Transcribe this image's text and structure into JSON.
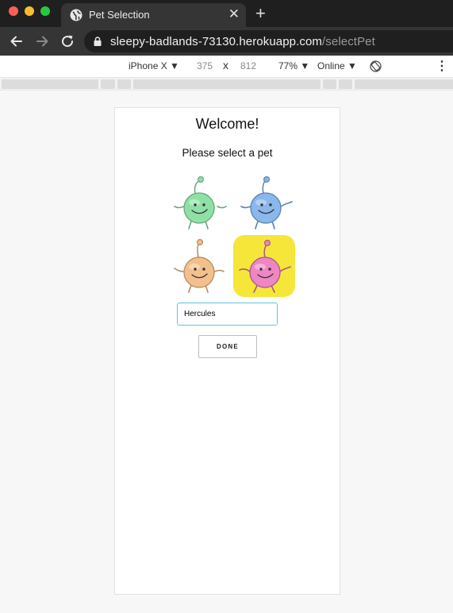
{
  "browser": {
    "tab": {
      "title": "Pet Selection",
      "close_glyph": "✕",
      "icon": "globe-icon"
    },
    "new_tab_glyph": "+",
    "address": {
      "host": "sleepy-badlands-73130.herokuapp.com",
      "path": "/selectPet",
      "icon": "lock-icon"
    },
    "nav_icons": [
      "back-arrow-icon",
      "forward-arrow-icon",
      "reload-icon"
    ]
  },
  "device_toolbar": {
    "device": "iPhone X ▼",
    "width": "375",
    "times": "x",
    "height": "812",
    "zoom": "77% ▼",
    "network": "Online ▼",
    "rotate_icon": "rotate-icon",
    "more": "⋮"
  },
  "page": {
    "heading": "Welcome!",
    "prompt": "Please select a pet",
    "pets": [
      {
        "name": "green-pet",
        "color": "#8fe0a6",
        "selected": false
      },
      {
        "name": "blue-pet",
        "color": "#8ab7ec",
        "selected": false
      },
      {
        "name": "orange-pet",
        "color": "#f2c08c",
        "selected": false
      },
      {
        "name": "pink-pet",
        "color": "#ef86c4",
        "selected": true
      }
    ],
    "selected_bg": "#f6e63a",
    "name_input_value": "Hercules",
    "done_label": "DONE"
  },
  "colors": {
    "chrome_dark": "#1f1f1f",
    "input_focus": "#5fc3dd"
  }
}
